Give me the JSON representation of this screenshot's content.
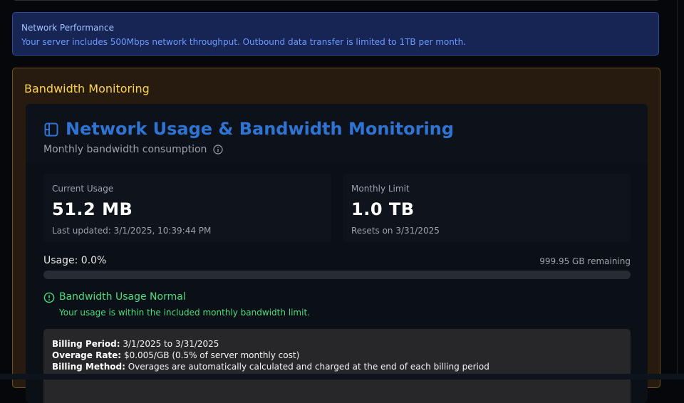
{
  "alert": {
    "title": "Network Performance",
    "text": "Your server includes 500Mbps network throughput. Outbound data transfer is limited to 1TB per month."
  },
  "bandwidth_panel": {
    "heading": "Bandwidth Monitoring",
    "title": "Network Usage & Bandwidth Monitoring",
    "subtitle": "Monthly bandwidth consumption",
    "title_icon": "network-icon",
    "info_icon": "info-icon"
  },
  "current_usage": {
    "label": "Current Usage",
    "value": "51.2 MB",
    "updated": "Last updated: 3/1/2025, 10:39:44 PM"
  },
  "monthly_limit": {
    "label": "Monthly Limit",
    "value": "1.0 TB",
    "resets": "Resets on 3/31/2025"
  },
  "usage": {
    "label": "Usage: 0.0%",
    "remaining": "999.95 GB remaining",
    "percent": 0.0
  },
  "status": {
    "title": "Bandwidth Usage Normal",
    "text": "Your usage is within the included monthly bandwidth limit.",
    "icon": "alert-circle-icon",
    "color": "#4ade80"
  },
  "billing": {
    "period_label": "Billing Period:",
    "period_value": "3/1/2025 to 3/31/2025",
    "rate_label": "Overage Rate:",
    "rate_value": "$0.005/GB (0.5% of server monthly cost)",
    "method_label": "Billing Method:",
    "method_value": "Overages are automatically calculated and charged at the end of each billing period"
  },
  "colors": {
    "accent_blue": "#2f73d3",
    "warning_panel": "#71501d",
    "success": "#22c55e"
  }
}
